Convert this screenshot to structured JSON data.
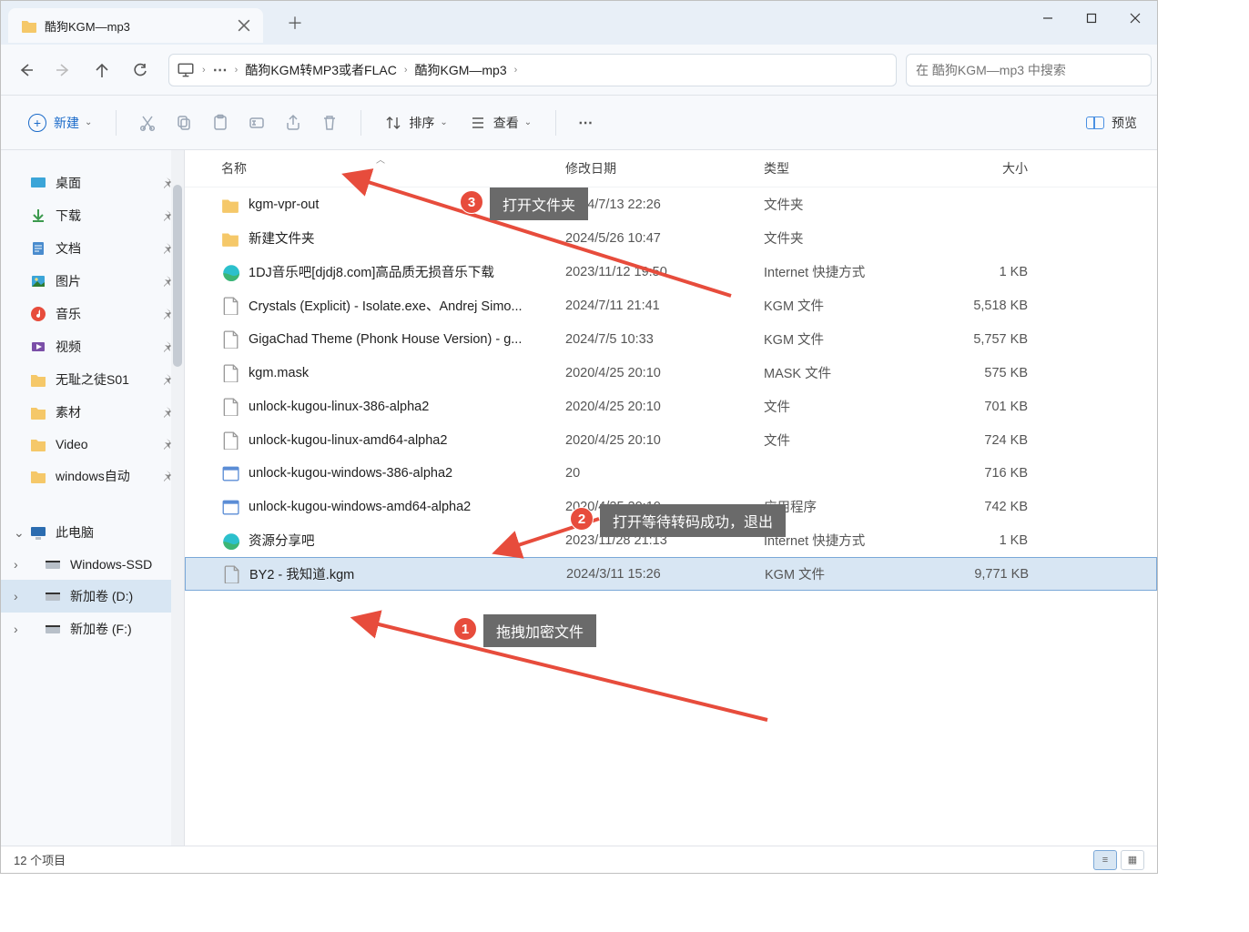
{
  "window": {
    "tab_title": "酷狗KGM—mp3"
  },
  "breadcrumbs": {
    "seg1": "酷狗KGM转MP3或者FLAC",
    "seg2": "酷狗KGM—mp3"
  },
  "search": {
    "placeholder": "在 酷狗KGM—mp3 中搜索"
  },
  "toolbar": {
    "new": "新建",
    "sort": "排序",
    "view_menu": "查看",
    "view_btn": "预览"
  },
  "headers": {
    "name": "名称",
    "date": "修改日期",
    "type": "类型",
    "size": "大小"
  },
  "sidebar": {
    "desktop": "桌面",
    "downloads": "下载",
    "documents": "文档",
    "pictures": "图片",
    "music": "音乐",
    "videos": "视频",
    "f_wuchi": "无耻之徒S01",
    "f_sucai": "素材",
    "f_video": "Video",
    "f_winauto": "windows自动",
    "thispc": "此电脑",
    "ssd": "Windows-SSD",
    "drive_d": "新加卷 (D:)",
    "drive_f": "新加卷 (F:)"
  },
  "rows": [
    {
      "icon": "folder",
      "name": "kgm-vpr-out",
      "date": "2024/7/13 22:26",
      "type": "文件夹",
      "size": ""
    },
    {
      "icon": "folder",
      "name": "新建文件夹",
      "date": "2024/5/26 10:47",
      "type": "文件夹",
      "size": ""
    },
    {
      "icon": "edge",
      "name": "1DJ音乐吧[djdj8.com]高品质无损音乐下载",
      "date": "2023/11/12 19:50",
      "type": "Internet 快捷方式",
      "size": "1 KB"
    },
    {
      "icon": "file",
      "name": "Crystals (Explicit) - Isolate.exe、Andrej Simo...",
      "date": "2024/7/11 21:41",
      "type": "KGM 文件",
      "size": "5,518 KB"
    },
    {
      "icon": "file",
      "name": "GigaChad Theme (Phonk House Version) - g...",
      "date": "2024/7/5 10:33",
      "type": "KGM 文件",
      "size": "5,757 KB"
    },
    {
      "icon": "file",
      "name": "kgm.mask",
      "date": "2020/4/25 20:10",
      "type": "MASK 文件",
      "size": "575 KB"
    },
    {
      "icon": "file",
      "name": "unlock-kugou-linux-386-alpha2",
      "date": "2020/4/25 20:10",
      "type": "文件",
      "size": "701 KB"
    },
    {
      "icon": "file",
      "name": "unlock-kugou-linux-amd64-alpha2",
      "date": "2020/4/25 20:10",
      "type": "文件",
      "size": "724 KB"
    },
    {
      "icon": "exe",
      "name": "unlock-kugou-windows-386-alpha2",
      "date": "20",
      "type": "",
      "size": "716 KB"
    },
    {
      "icon": "exe",
      "name": "unlock-kugou-windows-amd64-alpha2",
      "date": "2020/4/25 20:10",
      "type": "应用程序",
      "size": "742 KB"
    },
    {
      "icon": "edge",
      "name": "资源分享吧",
      "date": "2023/11/28 21:13",
      "type": "Internet 快捷方式",
      "size": "1 KB"
    },
    {
      "icon": "file",
      "name": "BY2 - 我知道.kgm",
      "date": "2024/3/11 15:26",
      "type": "KGM 文件",
      "size": "9,771 KB",
      "selected": true
    }
  ],
  "status": {
    "count": "12 个项目"
  },
  "annotations": {
    "a1": {
      "num": "1",
      "label": "拖拽加密文件"
    },
    "a2": {
      "num": "2",
      "label": "打开等待转码成功，退出"
    },
    "a3": {
      "num": "3",
      "label": "打开文件夹"
    }
  }
}
